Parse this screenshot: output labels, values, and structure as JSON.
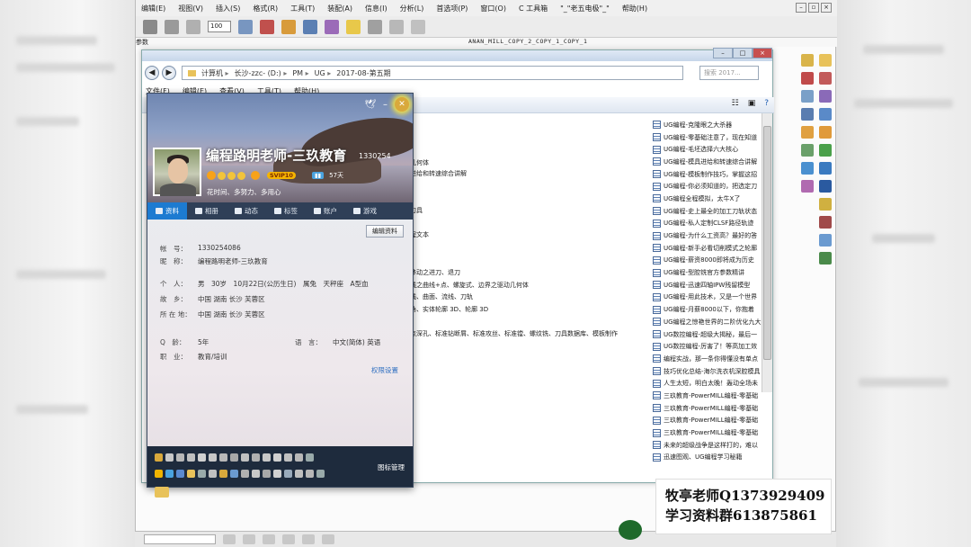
{
  "app": {
    "menu": [
      "编辑(E)",
      "视图(V)",
      "插入(S)",
      "格式(R)",
      "工具(T)",
      "装配(A)",
      "信息(I)",
      "分析(L)",
      "首选项(P)",
      "窗口(O)",
      "C 工具箱",
      "\"_\"老五电极\"_\"",
      "帮助(H)"
    ],
    "zoom_value": "100",
    "doc_left": "参数",
    "doc_title": "ANAN_MILL_COPY_2_COPY_1_COPY_1",
    "colors": {
      "accent": "#1d7bd1",
      "qq_dark": "#2f3f57"
    }
  },
  "explorer": {
    "breadcrumb": [
      "计算机",
      "长沙-zzc- (D:)",
      "PM",
      "UG",
      "2017-08-第五期"
    ],
    "search_placeholder": "搜索 2017...",
    "menu": [
      "文件(F)",
      "编辑(E)",
      "查看(V)",
      "工具(T)",
      "帮助(H)"
    ],
    "middle_lines": [
      "几何体",
      "进给和转速综合讲解",
      "刀具",
      "程文本",
      "移动之进刀、退刀",
      "线之曲线+点、螺旋式、边界之驱动几何体",
      "线、曲面、流线、刀轨",
      "角、实体轮廓 3D、轮廓 3D",
      "点深孔、标准钻断屑、标准攻丝、标准镗、螺纹铣、刀具数据库、模板制作"
    ],
    "files": [
      "UG编程-克隆眼之大杀器",
      "UG编程-零基础注意了，现在知道",
      "UG编程-毛坯选择六大核心",
      "UG编程-模具进给和转速综合讲解",
      "UG编程-模板制作技巧，掌握这招",
      "UG编程-你必须知道的，把选定刀",
      "UG编程全程模拟，太牛X了",
      "UG编程-史上最全的加工刀轨状态",
      "UG编程-私人定制CLSF路径轨迹",
      "UG编程-为什么工资高？最好的答",
      "UG编程-新手必看切削模式之轮廓",
      "UG编程-薪资8000即将成为历史",
      "UG编程-型腔铣官方参数精讲",
      "UG编程-迅速四轴IPW残留模型",
      "UG编程-用此技术，又是一个世界",
      "UG编程-月薪8000以下，你抱着",
      "UG编程之惊艳世界的二阶优化九大",
      "UG数控编程-超级大揭秘，最后一",
      "UG数控编程-厉害了！等高加工效",
      "编程实战，那一条你得懂没有单点",
      "技巧优化总结-海尔洗衣机深腔模具",
      "人生太短，明白太晚！轰动全场未",
      "三玖教育-PowerMILL编程-零基础",
      "三玖教育-PowerMILL编程-零基础",
      "三玖教育-PowerMILL编程-零基础",
      "三玖教育-PowerMILL编程-零基础",
      "未来的超级战争是这样打的，难以",
      "迅速图观、UG编程学习秘籍"
    ]
  },
  "qq": {
    "name": "编程路明老师-三玖教育",
    "id_short": "1330254",
    "badge_svip": "SVIP10",
    "days": "57天",
    "signature": "花时间、多努力、多用心",
    "tabs": [
      "资料",
      "相册",
      "动态",
      "标签",
      "账户",
      "游戏"
    ],
    "edit_button": "编辑资料",
    "info": [
      {
        "k": "帐　号：",
        "v": "1330254086"
      },
      {
        "k": "昵　称：",
        "v": "编程路明老师-三玖教育"
      },
      {
        "k": "个　人：",
        "v": "男　30岁　10月22日(公历生日)　属兔　天秤座　A型血"
      },
      {
        "k": "故　乡：",
        "v": "中国 湖南 长沙 芙蓉区"
      },
      {
        "k": "所 在 地：",
        "v": "中国 湖南 长沙 芙蓉区"
      },
      {
        "k": "Q　龄：",
        "v": "5年"
      },
      {
        "k": "职　业：",
        "v": "教育/培训"
      }
    ],
    "language_label": "语　言：",
    "language_value": "中文(简体) 英语",
    "permission_link": "权限设置",
    "icon_manage": "图标管理"
  },
  "watermark": {
    "line1": "牧亭老师Q1373929409",
    "line2": "学习资料群613875861"
  }
}
